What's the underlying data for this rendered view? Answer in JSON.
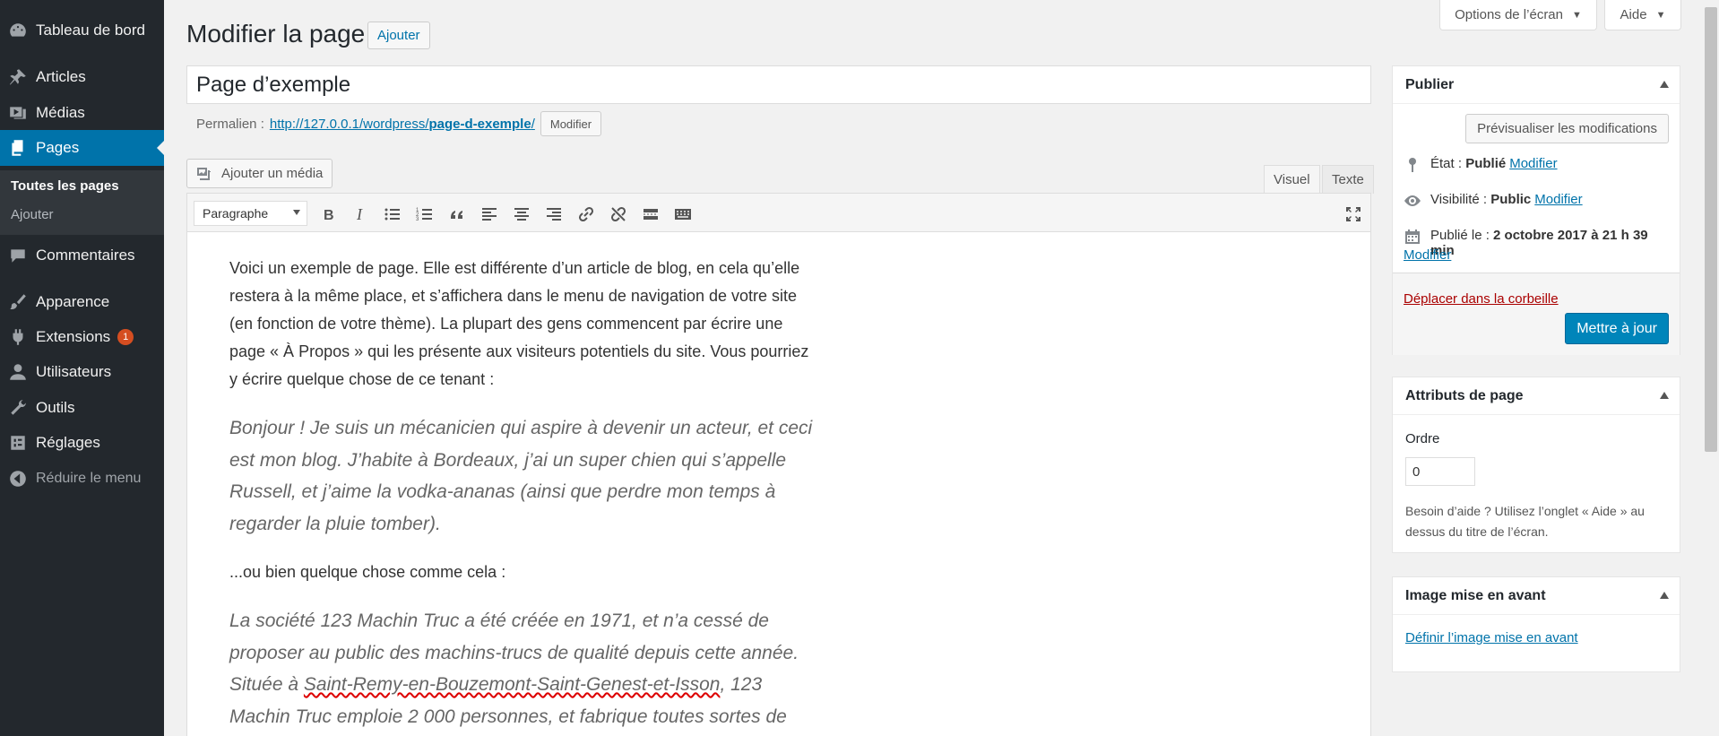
{
  "sidebar": {
    "items": [
      {
        "label": "Tableau de bord",
        "icon": "dashboard-icon"
      },
      {
        "label": "Articles",
        "icon": "pushpin-icon"
      },
      {
        "label": "Médias",
        "icon": "media-icon"
      },
      {
        "label": "Pages",
        "icon": "pages-icon"
      },
      {
        "label": "Commentaires",
        "icon": "comment-icon"
      },
      {
        "label": "Apparence",
        "icon": "paintbrush-icon"
      },
      {
        "label": "Extensions",
        "icon": "plugin-icon",
        "badge": "1"
      },
      {
        "label": "Utilisateurs",
        "icon": "user-icon"
      },
      {
        "label": "Outils",
        "icon": "wrench-icon"
      },
      {
        "label": "Réglages",
        "icon": "settings-icon"
      },
      {
        "label": "Réduire le menu",
        "icon": "collapse-icon"
      }
    ],
    "submenu": [
      "Toutes les pages",
      "Ajouter"
    ]
  },
  "screen_meta": {
    "options_label": "Options de l’écran",
    "help_label": "Aide"
  },
  "header": {
    "title": "Modifier la page",
    "add_label": "Ajouter"
  },
  "post": {
    "title": "Page d’exemple",
    "permalink_label": "Permalien :",
    "permalink_base": "http://127.0.0.1/wordpress/",
    "permalink_slug": "page-d-exemple",
    "permalink_end": "/",
    "edit_label": "Modifier"
  },
  "editor": {
    "add_media_label": "Ajouter un média",
    "tab_visual": "Visuel",
    "tab_text": "Texte",
    "format_value": "Paragraphe",
    "content": {
      "p1": "Voici un exemple de page. Elle est différente d’un article de blog, en cela qu’elle restera à la même place, et s’affichera dans le menu de navigation de votre site (en fonction de votre thème). La plupart des gens commencent par écrire une page « À Propos » qui les présente aux visiteurs potentiels du site. Vous pourriez y écrire quelque chose de ce tenant :",
      "q1": "Bonjour ! Je suis un mécanicien qui aspire à devenir un acteur, et ceci est mon blog. J’habite à Bordeaux, j’ai un super chien qui s’appelle Russell, et j’aime la vodka-ananas (ainsi que perdre mon temps à regarder la pluie tomber).",
      "p2": "...ou bien quelque chose comme cela :",
      "q2_start": "La société 123 Machin Truc a été créée en 1971, et n’a cessé de proposer au public des machins-trucs de qualité depuis cette année. Située à ",
      "q2_place": "Saint-Remy-en-Bouzemont-Saint-Genest-et-Isson",
      "q2_end": ", 123 Machin Truc emploie 2 000 personnes, et fabrique toutes sortes de"
    }
  },
  "publish": {
    "title": "Publier",
    "preview_label": "Prévisualiser les modifications",
    "status_label": "État :",
    "status_value": "Publié",
    "visibility_label": "Visibilité :",
    "visibility_value": "Public",
    "published_label": "Publié le :",
    "published_value": "2 octobre 2017 à 21 h 39 min",
    "modify_label": "Modifier",
    "trash_label": "Déplacer dans la corbeille",
    "update_label": "Mettre à jour"
  },
  "attributes": {
    "title": "Attributs de page",
    "order_label": "Ordre",
    "order_value": "0",
    "help_text": "Besoin d’aide ? Utilisez l’onglet « Aide » au dessus du titre de l’écran."
  },
  "featured": {
    "title": "Image mise en avant",
    "set_label": "Définir l’image mise en avant"
  },
  "colors": {
    "sidebar_bg": "#23282d",
    "accent": "#0073aa",
    "primary_button": "#0085ba",
    "badge": "#d54e21",
    "trash": "#a00"
  }
}
